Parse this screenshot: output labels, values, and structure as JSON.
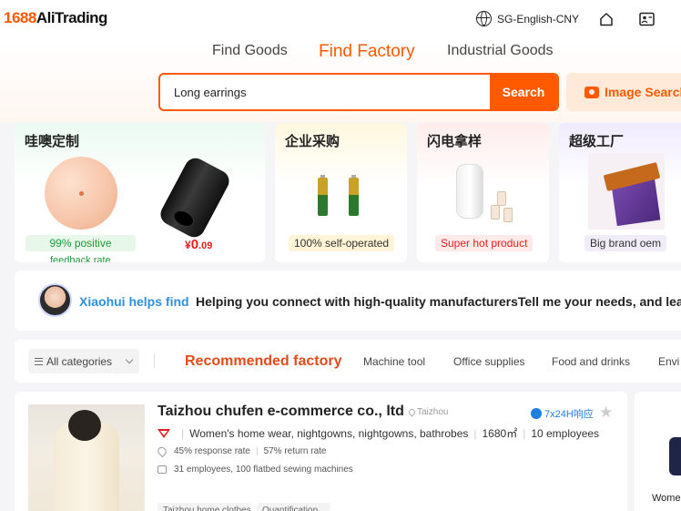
{
  "header": {
    "logo_num": "1688",
    "logo_text": "AliTrading",
    "language": "SG-English-CNY",
    "home_icon": "home-icon",
    "card_icon": "id-card-icon"
  },
  "nav": {
    "tabs": [
      {
        "label": "Find Goods"
      },
      {
        "label": "Find Factory",
        "active": true
      },
      {
        "label": "Industrial Goods"
      }
    ]
  },
  "search": {
    "value": "Long earrings",
    "button": "Search",
    "image_search": "Image Search"
  },
  "promos": [
    {
      "title": "哇噢定制",
      "tag": "99% positive",
      "subtag": "feedback rate",
      "price_symbol": "¥",
      "price_int": "0",
      "price_dec": ".09"
    },
    {
      "title": "企业采购",
      "tag": "100% self-operated"
    },
    {
      "title": "闪电拿样",
      "tag": "Super hot product"
    },
    {
      "title": "超级工厂",
      "tag": "Big brand oem"
    }
  ],
  "assistant": {
    "name": "Xiaohui helps find",
    "message": "Helping you connect with high-quality manufacturersTell me your needs, and lea"
  },
  "categories": {
    "select_label": "All categories",
    "active": "Recommended factory",
    "items": [
      "Machine tool",
      "Office supplies",
      "Food and drinks",
      "Envi"
    ]
  },
  "factory": {
    "name": "Taizhou chufen e-commerce co., ltd",
    "location": "Taizhou",
    "chat_label": "7x24H响应",
    "products": "Women's home wear, nightgowns, nightgowns, bathrobes",
    "area": "1680㎡",
    "employees": "10 employees",
    "response_rate": "45% response rate",
    "return_rate": "57% return rate",
    "equipment": "31 employees, 100 flatbed sewing machines",
    "chips": [
      "Taizhou home clothes",
      "Quantification"
    ]
  },
  "side_card": {
    "label": "Women"
  },
  "colors": {
    "accent": "#ff5a00",
    "link_blue": "#2f8fe0",
    "category_active": "#e34b1a"
  }
}
